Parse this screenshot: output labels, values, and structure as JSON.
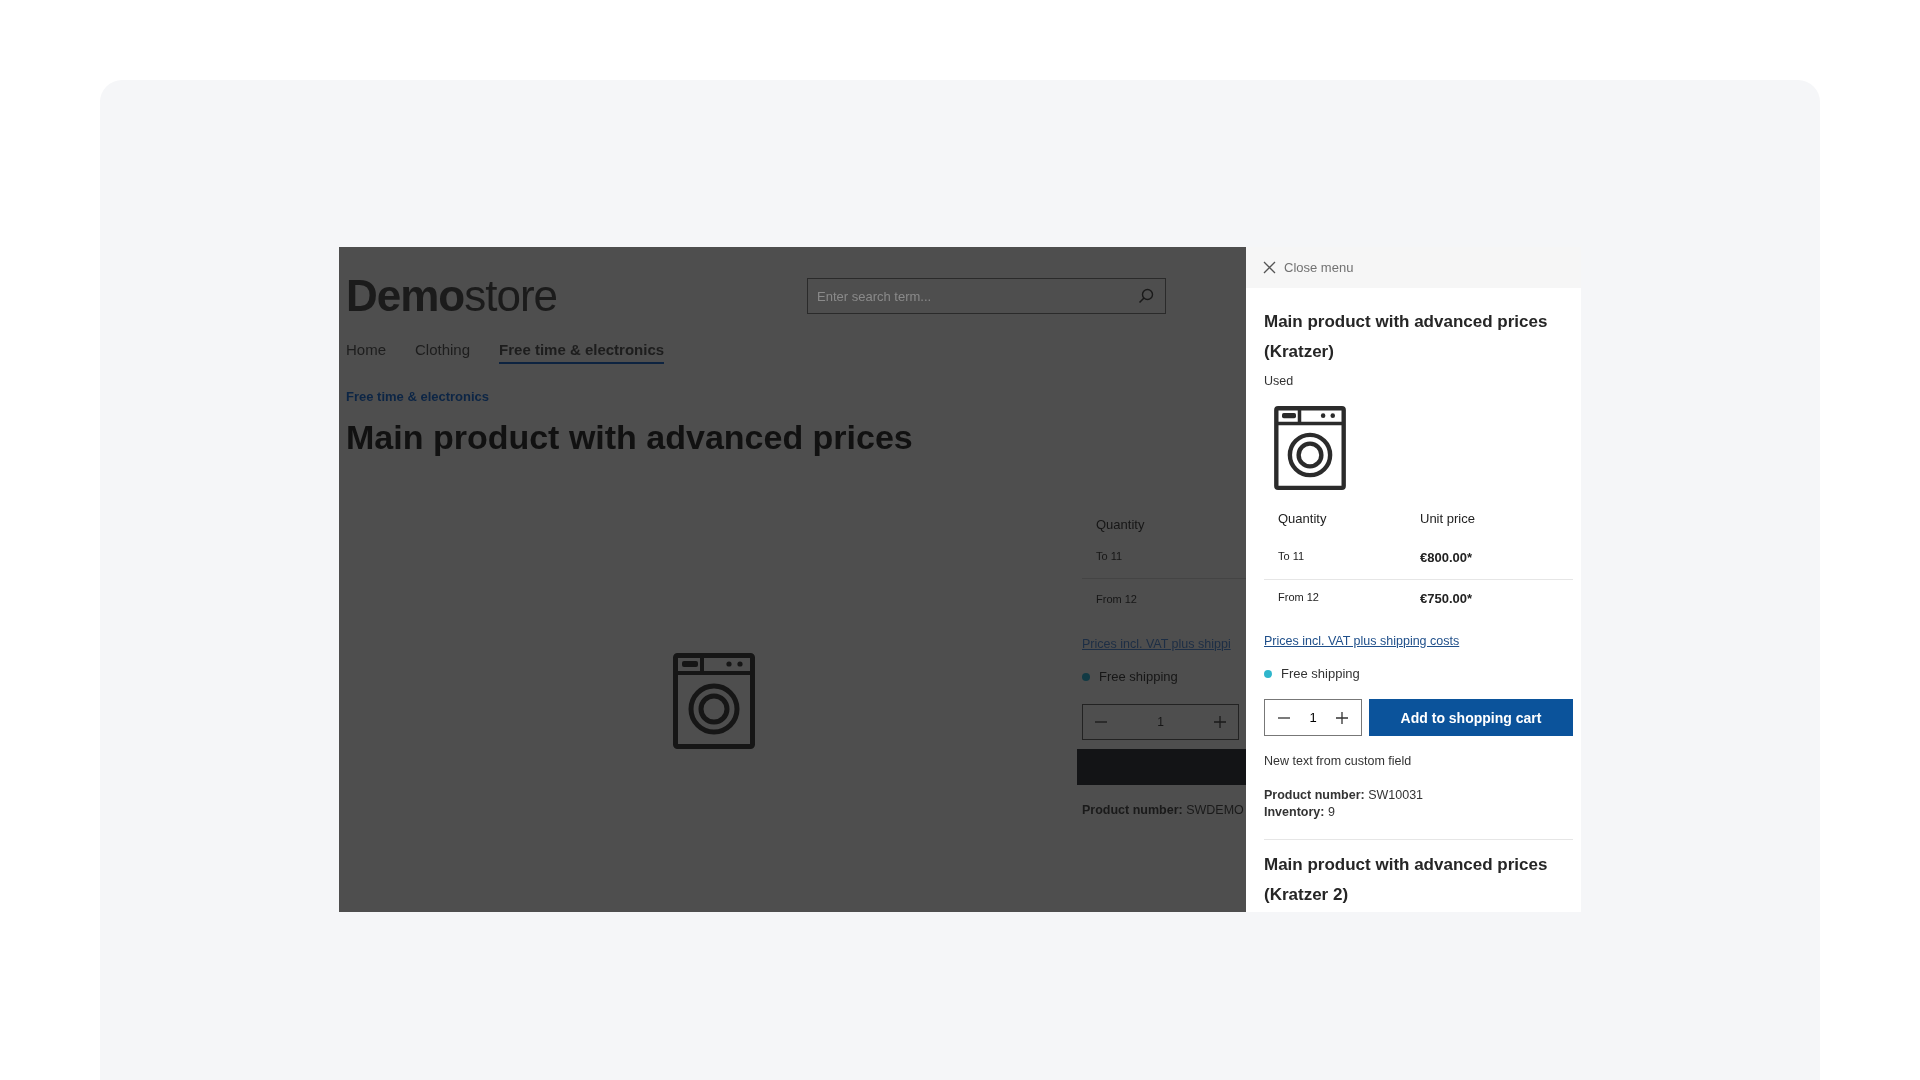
{
  "store_page": {
    "logo": {
      "bold": "Demo",
      "light": "store"
    },
    "search": {
      "placeholder": "Enter search term..."
    },
    "nav": [
      {
        "label": "Home",
        "selected": false
      },
      {
        "label": "Clothing",
        "selected": false
      },
      {
        "label": "Free time & electronics",
        "selected": true
      }
    ],
    "breadcrumb": "Free time & electronics",
    "title": "Main product with advanced prices",
    "price_table": {
      "header": "Quantity",
      "rows": [
        "To 11",
        "From 12"
      ]
    },
    "vat_link": "Prices incl. VAT plus shippi",
    "shipping": "Free shipping",
    "quantity": "1",
    "product_number": {
      "label": "Product number:",
      "value": "SWDEMO"
    }
  },
  "offcanvas": {
    "close_label": "Close menu",
    "offers": [
      {
        "title": "Main product with advanced prices (Kratzer)",
        "condition": "Used",
        "table": {
          "columns": [
            "Quantity",
            "Unit price"
          ],
          "rows": [
            [
              "To 11",
              "€800.00*"
            ],
            [
              "From 12",
              "€750.00*"
            ]
          ]
        },
        "vat_link": "Prices incl. VAT plus shipping costs",
        "shipping": "Free shipping",
        "quantity": "1",
        "button": "Add to shopping cart",
        "custom_text": "New text from custom field",
        "details": [
          {
            "label": "Product number:",
            "value": "SW10031"
          },
          {
            "label": "Inventory:",
            "value": "9"
          }
        ]
      },
      {
        "title": "Main product with advanced prices (Kratzer 2)"
      }
    ]
  }
}
